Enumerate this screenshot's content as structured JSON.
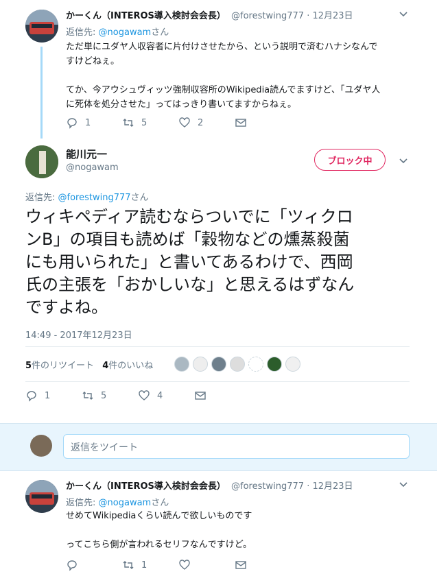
{
  "tweet1": {
    "author_name": "かーくん（INTEROS導入検討会会長）",
    "handle": "@forestwing777",
    "date": "12月23日",
    "reply_label": "返信先:",
    "reply_handle": "@nogawam",
    "reply_suffix": "さん",
    "text_lines": [
      "ただ単にユダヤ人収容者に片付けさせたから、という説明で済むハナシなんで",
      "すけどねぇ。",
      "",
      "てか、今アウシュヴィッツ強制収容所のWikipedia読んでますけど、「ユダヤ人",
      "に死体を処分させた」ってはっきり書いてますからねぇ。"
    ],
    "reply_count": "1",
    "retweet_count": "5",
    "like_count": "2"
  },
  "main": {
    "author_name": "能川元一",
    "handle": "@nogawam",
    "block_label": "ブロック中",
    "reply_label": "返信先:",
    "reply_handle": "@forestwing777",
    "reply_suffix": "さん",
    "text_lines": [
      "ウィキペディア読むならついでに「ツィクロ",
      "ンB」の項目も読めば「穀物などの燻蒸殺菌",
      "にも用いられた」と書いてあるわけで、西岡",
      "氏の主張を「おかしいな」と思えるはずなん",
      "ですよね。"
    ],
    "timestamp": "14:49 - 2017年12月23日",
    "retweets_num": "5",
    "retweets_label": "件のリツイート",
    "likes_num": "4",
    "likes_label": "件のいいね",
    "reply_count": "1",
    "retweet_count": "5",
    "like_count": "4"
  },
  "composer": {
    "placeholder": "返信をツイート"
  },
  "tweet3": {
    "author_name": "かーくん（INTEROS導入検討会会長）",
    "handle": "@forestwing777",
    "date": "12月23日",
    "reply_label": "返信先:",
    "reply_handle": "@nogawam",
    "reply_suffix": "さん",
    "text_lines": [
      "せめてWikipediaくらい読んで欲しいものです",
      "",
      "ってこちら側が言われるセリフなんですけど。"
    ],
    "retweet_count": "1"
  },
  "colors": {
    "accent": "#1da1f2",
    "link": "#1b95e0",
    "block": "#e0245e",
    "muted": "#657786",
    "thread_line": "#a5d9f8",
    "composer_bg": "#e8f5fd"
  }
}
